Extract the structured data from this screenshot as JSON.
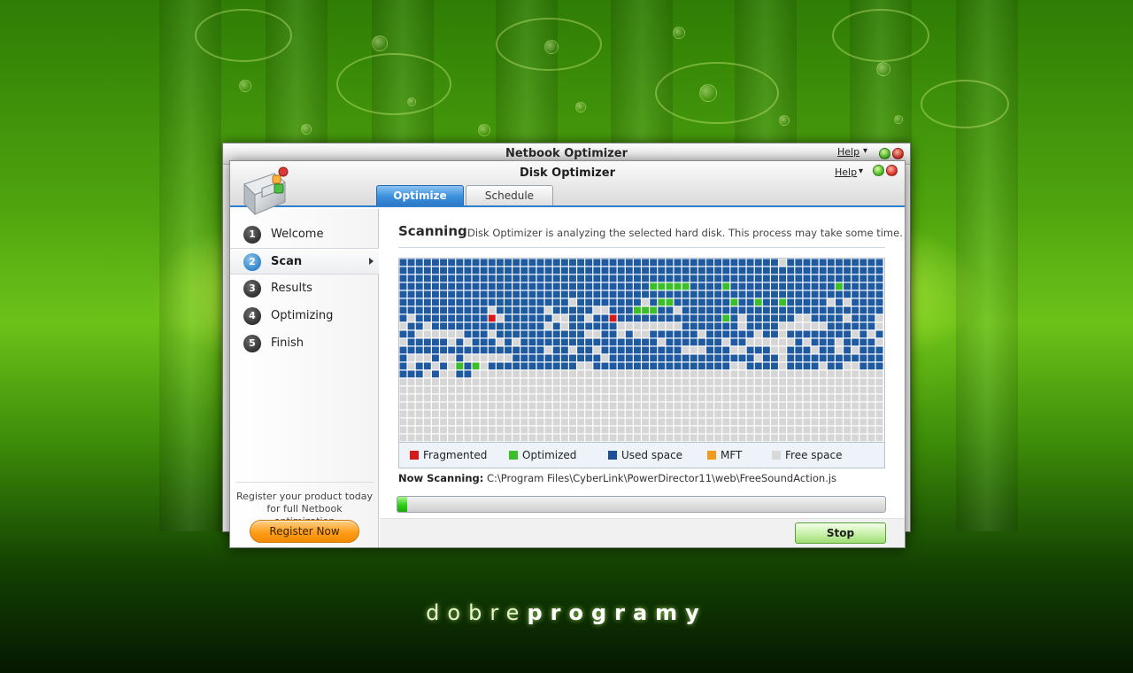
{
  "brand": {
    "light": "dobre",
    "bold": "programy"
  },
  "back_window": {
    "title": "Netbook Optimizer",
    "help_label": "Help",
    "help_arrow": "▾"
  },
  "front_window": {
    "title": "Disk Optimizer",
    "help_label": "Help",
    "help_arrow": "▾",
    "logo_icon": "disk-optimizer-logo-icon"
  },
  "tabs": [
    {
      "label": "Optimize",
      "active": true
    },
    {
      "label": "Schedule",
      "active": false
    }
  ],
  "steps": [
    {
      "number": "1",
      "label": "Welcome",
      "active": false
    },
    {
      "number": "2",
      "label": "Scan",
      "active": true
    },
    {
      "number": "3",
      "label": "Results",
      "active": false
    },
    {
      "number": "4",
      "label": "Optimizing",
      "active": false
    },
    {
      "number": "5",
      "label": "Finish",
      "active": false
    }
  ],
  "register": {
    "text_line1": "Register your product today",
    "text_line2": "for full Netbook optimization",
    "button_label": "Register Now"
  },
  "scan": {
    "heading": "Scanning",
    "description": "Disk Optimizer is analyzing the selected hard disk. This process may take some time.",
    "now_scanning_label": "Now Scanning:",
    "now_scanning_path": "C:\\Program Files\\CyberLink\\PowerDirector11\\web\\FreeSoundAction.js",
    "progress_fraction": 0.02,
    "stop_label": "Stop"
  },
  "legend": [
    {
      "label": "Fragmented",
      "color": "#d8191c"
    },
    {
      "label": "Optimized",
      "color": "#3cbe2a"
    },
    {
      "label": "Used space",
      "color": "#1f4f96"
    },
    {
      "label": "MFT",
      "color": "#f39a1e"
    },
    {
      "label": "Free space",
      "color": "#d9d9d9"
    }
  ],
  "colors": {
    "used": "#1f5aa0",
    "free": "#d6d6d6",
    "fragmented": "#d8191c",
    "optimized": "#3cbe2a",
    "accent": "#2f7fcf"
  }
}
